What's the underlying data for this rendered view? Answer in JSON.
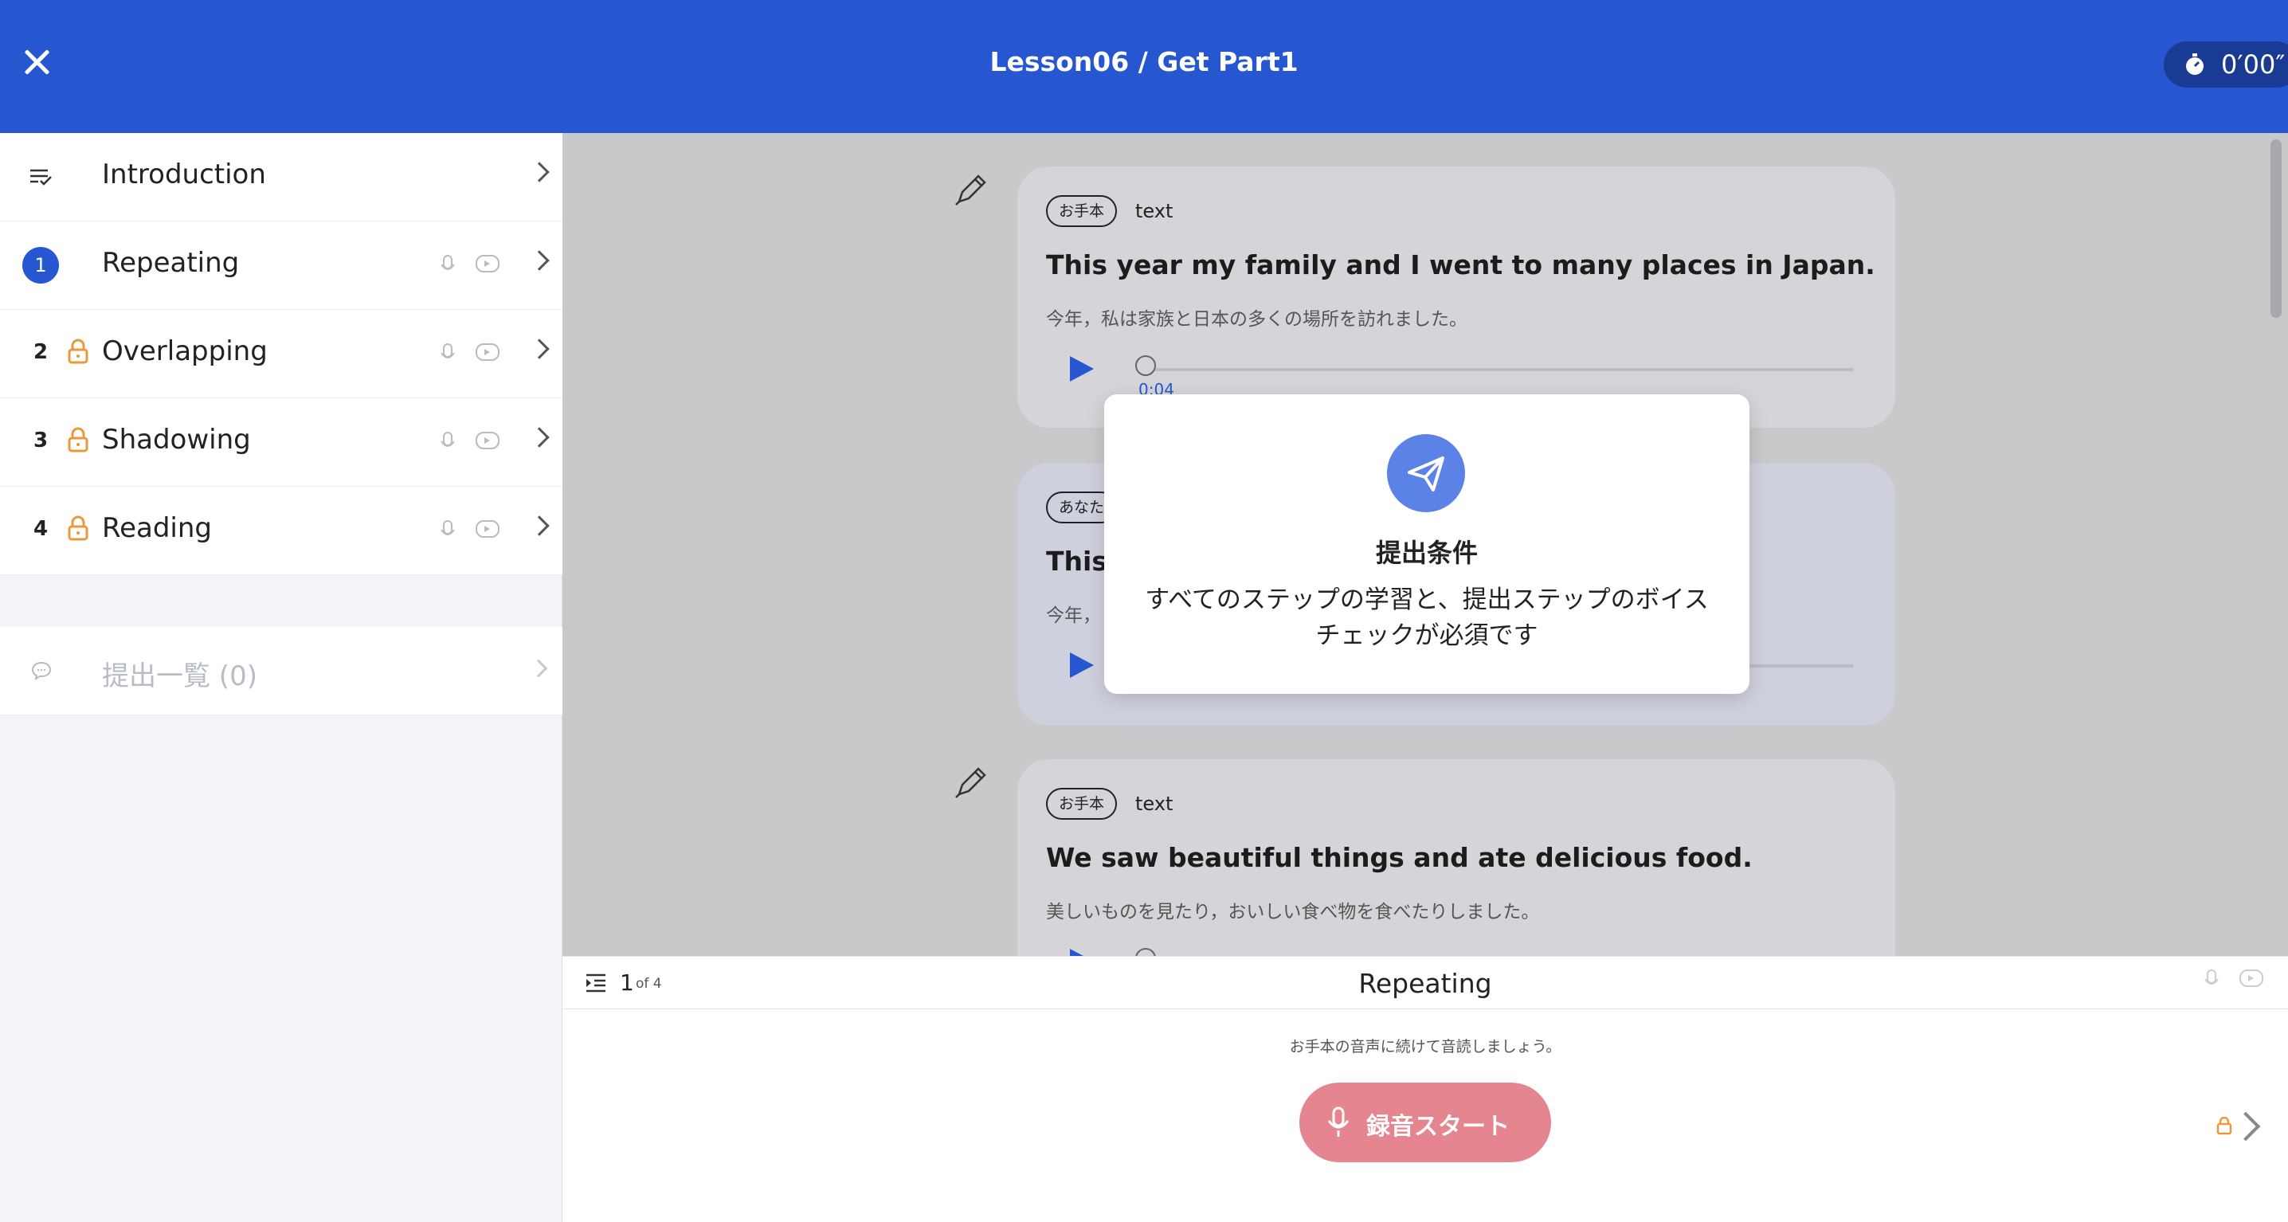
{
  "header": {
    "title": "Lesson06 / Get Part1",
    "timer": "0′00″"
  },
  "sidebar": {
    "intro": {
      "label": "Introduction",
      "icon": "checklist-icon"
    },
    "steps": [
      {
        "num": "1",
        "label": "Repeating",
        "locked": false,
        "active": true
      },
      {
        "num": "2",
        "label": "Overlapping",
        "locked": true,
        "active": false
      },
      {
        "num": "3",
        "label": "Shadowing",
        "locked": true,
        "active": false
      },
      {
        "num": "4",
        "label": "Reading",
        "locked": true,
        "active": false
      }
    ],
    "submissions": {
      "label": "提出一覧 (0)",
      "icon": "chat-bubble-icon"
    }
  },
  "cards": [
    {
      "badge": "お手本",
      "tag": "text",
      "en": "This year my family and I went to many places in Japan.",
      "ja": "今年，私は家族と日本の多くの場所を訪れました。",
      "time": "0:04"
    },
    {
      "badge": "あなた",
      "en": "This",
      "ja": "今年，"
    },
    {
      "badge": "お手本",
      "tag": "text",
      "en": "We saw beautiful things and ate delicious food.",
      "ja": "美しいものを見たり，おいしい食べ物を食べたりしました。"
    }
  ],
  "modal": {
    "icon": "paper-plane-icon",
    "title": "提出条件",
    "body": "すべてのステップの学習と、提出ステップのボイスチェックが必須です"
  },
  "bottom": {
    "page": "1",
    "of": "of 4",
    "title": "Repeating",
    "hint": "お手本の音声に続けて音読しましょう。",
    "record_label": "録音スタート"
  },
  "colors": {
    "header": "#2657d0",
    "record": "#e5858f",
    "lock": "#e8993e"
  }
}
